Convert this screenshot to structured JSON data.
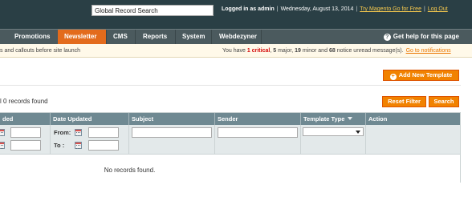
{
  "header": {
    "search_value": "Global Record Search",
    "logged_in_label": "Logged in as admin",
    "date": "Wednesday, August 13, 2014",
    "try_link": "Try Magento Go for Free",
    "logout_link": "Log Out"
  },
  "nav": {
    "items": [
      {
        "label": "Promotions"
      },
      {
        "label": "Newsletter"
      },
      {
        "label": "CMS"
      },
      {
        "label": "Reports"
      },
      {
        "label": "System"
      },
      {
        "label": "Webdezyner"
      }
    ],
    "active": "Newsletter",
    "help": "Get help for this page"
  },
  "notice": {
    "left_text": "s and callouts before site launch",
    "prefix": "You have",
    "critical_count": "1",
    "critical_label": "critical",
    "major_count": "5",
    "major_label": "major",
    "minor_count": "19",
    "minor_label": "minor and",
    "notice_count": "68",
    "notice_label": "notice unread message(s).",
    "goto_link": "Go to notifications"
  },
  "actions": {
    "add_template": "Add New Template",
    "reset_filter": "Reset Filter",
    "search": "Search"
  },
  "grid": {
    "records_text": "l 0 records found",
    "columns": [
      "ded",
      "Date Updated",
      "Subject",
      "Sender",
      "Template Type",
      "Action"
    ],
    "filter_from": "From:",
    "filter_to": "To :",
    "empty_text": "No records found."
  },
  "colors": {
    "header_bg": "#2a3f45",
    "nav_bg": "#4b5a5e",
    "accent": "#e36b1c",
    "button": "#f18200",
    "grid_head": "#6f8992"
  }
}
